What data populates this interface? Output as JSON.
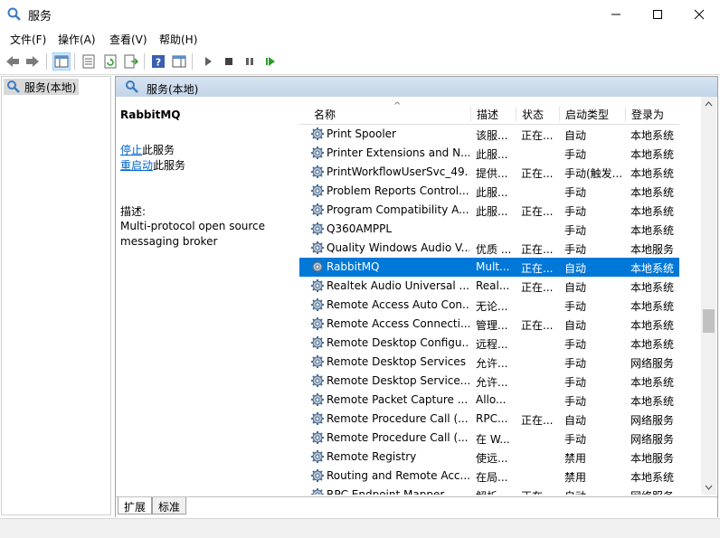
{
  "window": {
    "title": "服务",
    "minimize": "—",
    "maximize": "☐",
    "close": "✕"
  },
  "menu": [
    "文件(F)",
    "操作(A)",
    "查看(V)",
    "帮助(H)"
  ],
  "tree": {
    "root_label": "服务(本地)"
  },
  "main": {
    "header_label": "服务(本地)",
    "selected_service": "RabbitMQ",
    "stop_link": "停止",
    "stop_suffix": "此服务",
    "restart_link": "重启动",
    "restart_suffix": "此服务",
    "desc_label": "描述:",
    "desc_text": "Multi-protocol open source messaging broker"
  },
  "columns": {
    "name": "名称",
    "description": "描述",
    "status": "状态",
    "startup": "启动类型",
    "logon": "登录为",
    "sort_arrow": "^"
  },
  "rows": [
    {
      "name": "Print Spooler",
      "description": "该服...",
      "status": "正在...",
      "startup": "自动",
      "logon": "本地系统"
    },
    {
      "name": "Printer Extensions and N...",
      "description": "此服...",
      "status": "",
      "startup": "手动",
      "logon": "本地系统"
    },
    {
      "name": "PrintWorkflowUserSvc_49...",
      "description": "提供...",
      "status": "正在...",
      "startup": "手动(触发...",
      "logon": "本地系统"
    },
    {
      "name": "Problem Reports Control...",
      "description": "此服...",
      "status": "",
      "startup": "手动",
      "logon": "本地系统"
    },
    {
      "name": "Program Compatibility A...",
      "description": "此服...",
      "status": "正在...",
      "startup": "手动",
      "logon": "本地系统"
    },
    {
      "name": "Q360AMPPL",
      "description": "",
      "status": "",
      "startup": "手动",
      "logon": "本地系统"
    },
    {
      "name": "Quality Windows Audio V...",
      "description": "优质 ...",
      "status": "正在...",
      "startup": "手动",
      "logon": "本地服务"
    },
    {
      "name": "RabbitMQ",
      "description": "Mult...",
      "status": "正在...",
      "startup": "自动",
      "logon": "本地系统",
      "selected": true
    },
    {
      "name": "Realtek Audio Universal ...",
      "description": "Real...",
      "status": "正在...",
      "startup": "自动",
      "logon": "本地系统"
    },
    {
      "name": "Remote Access Auto Con...",
      "description": "无论...",
      "status": "",
      "startup": "手动",
      "logon": "本地系统"
    },
    {
      "name": "Remote Access Connecti...",
      "description": "管理...",
      "status": "正在...",
      "startup": "自动",
      "logon": "本地系统"
    },
    {
      "name": "Remote Desktop Configu...",
      "description": "远程...",
      "status": "",
      "startup": "手动",
      "logon": "本地系统"
    },
    {
      "name": "Remote Desktop Services",
      "description": "允许...",
      "status": "",
      "startup": "手动",
      "logon": "网络服务"
    },
    {
      "name": "Remote Desktop Service...",
      "description": "允许...",
      "status": "",
      "startup": "手动",
      "logon": "本地系统"
    },
    {
      "name": "Remote Packet Capture ...",
      "description": "Allo...",
      "status": "",
      "startup": "手动",
      "logon": "本地系统"
    },
    {
      "name": "Remote Procedure Call (...",
      "description": "RPC...",
      "status": "正在...",
      "startup": "自动",
      "logon": "网络服务"
    },
    {
      "name": "Remote Procedure Call (...",
      "description": "在 W...",
      "status": "",
      "startup": "手动",
      "logon": "网络服务"
    },
    {
      "name": "Remote Registry",
      "description": "使远...",
      "status": "",
      "startup": "禁用",
      "logon": "本地服务"
    },
    {
      "name": "Routing and Remote Acc...",
      "description": "在局...",
      "status": "",
      "startup": "禁用",
      "logon": "本地系统"
    },
    {
      "name": "RPC Endpoint Mapper",
      "description": "解析...",
      "status": "正在...",
      "startup": "自动",
      "logon": "网络服务"
    }
  ],
  "tabs": [
    "扩展",
    "标准"
  ],
  "colors": {
    "selection": "#0078d7",
    "link": "#0066cc",
    "header": "#c3d4e8"
  }
}
